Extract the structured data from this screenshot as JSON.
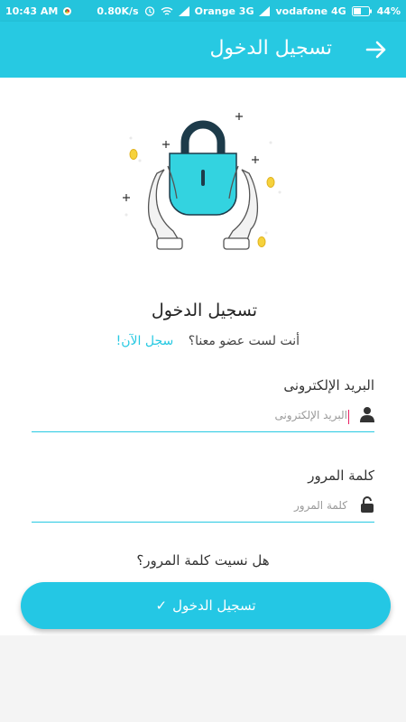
{
  "status_bar": {
    "time": "10:43 AM",
    "speed": "0.80K/s",
    "carrier1": "Orange 3G",
    "carrier2": "vodafone 4G",
    "battery": "44%"
  },
  "toolbar": {
    "title": "تسجيل الدخول",
    "back_icon": "arrow-right-icon"
  },
  "main": {
    "heading": "تسجيل الدخول",
    "not_member_text": "أنت لست عضو معنا؟",
    "signup_link": "سجل الآن!",
    "email": {
      "label": "البريد الإلكترونى",
      "placeholder": "البريد الإلكترونى",
      "icon": "user-icon"
    },
    "password": {
      "label": "كلمة المرور",
      "placeholder": "كلمة المرور",
      "icon": "unlock-icon"
    },
    "forgot_password": "هل نسيت كلمة المرور؟",
    "login_button": "تسجيل الدخول",
    "login_button_icon": "✓"
  },
  "colors": {
    "accent": "#27c9e2",
    "lock_body": "#33d3e0",
    "lock_shackle": "#1d3b4a",
    "coin": "#f6d23c"
  }
}
